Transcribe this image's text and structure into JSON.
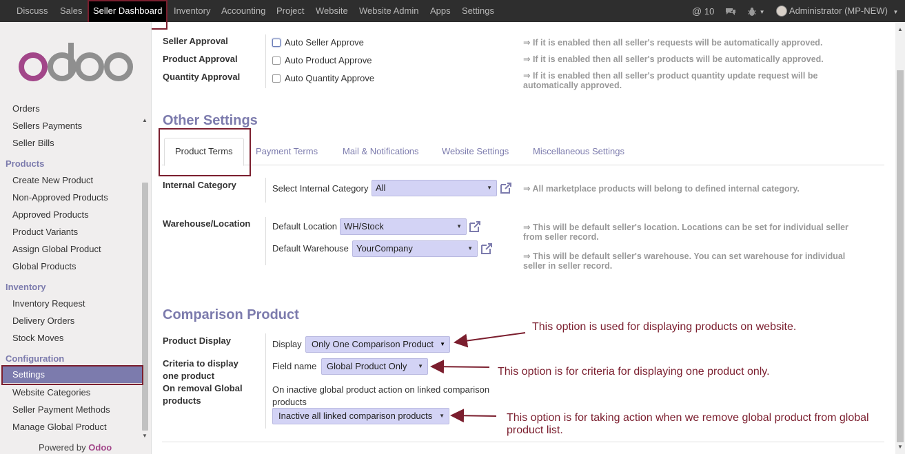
{
  "topbar": {
    "menus": [
      "Discuss",
      "Sales",
      "Seller Dashboard",
      "Inventory",
      "Accounting",
      "Project",
      "Website",
      "Website Admin",
      "Apps",
      "Settings"
    ],
    "messages_count": "10",
    "user": "Administrator (MP-NEW)"
  },
  "sidebar": {
    "items_top": [
      "Orders",
      "Sellers Payments",
      "Seller Bills"
    ],
    "products_header": "Products",
    "products_items": [
      "Create New Product",
      "Non-Approved Products",
      "Approved Products",
      "Product Variants",
      "Assign Global Product",
      "Global Products"
    ],
    "inventory_header": "Inventory",
    "inventory_items": [
      "Inventory Request",
      "Delivery Orders",
      "Stock Moves"
    ],
    "config_header": "Configuration",
    "config_items": [
      "Settings",
      "Website Categories",
      "Seller Payment Methods",
      "Manage Global Product"
    ],
    "powered_by": "Powered by",
    "powered_brand": "Odoo"
  },
  "approval": {
    "seller_label": "Seller Approval",
    "product_label": "Product Approval",
    "quantity_label": "Quantity Approval",
    "seller_option": "Auto Seller Approve",
    "product_option": "Auto Product Approve",
    "quantity_option": "Auto Quantity Approve",
    "seller_help": "⇒ If it is enabled then all seller's requests will be automatically approved.",
    "product_help": "⇒ If it is enabled then all seller's products will be automatically approved.",
    "quantity_help": "⇒ If it is enabled then all seller's product quantity update request will be automatically approved."
  },
  "other_settings": {
    "title": "Other Settings",
    "tabs": [
      "Product Terms",
      "Payment Terms",
      "Mail & Notifications",
      "Website Settings",
      "Miscellaneous Settings"
    ],
    "internal_category_label": "Internal Category",
    "select_internal_category": "Select Internal Category",
    "internal_category_value": "All",
    "internal_category_help": "⇒ All marketplace products will belong to defined internal category.",
    "warehouse_label": "Warehouse/Location",
    "default_location": "Default Location",
    "default_location_value": "WH/Stock",
    "default_warehouse": "Default Warehouse",
    "default_warehouse_value": "YourCompany",
    "location_help": "⇒ This will be default seller's location. Locations can be set for individual seller from seller record.",
    "warehouse_help": "⇒ This will be default seller's warehouse. You can set warehouse for individual seller in seller record."
  },
  "comparison": {
    "title": "Comparison Product",
    "product_display_label": "Product Display",
    "display_field": "Display",
    "display_value": "Only One Comparison Product",
    "criteria_label": "Criteria to display one product",
    "field_name": "Field name",
    "field_value": "Global Product Only",
    "removal_label": "On removal Global products",
    "removal_text": "On inactive global product action on linked comparison products",
    "removal_value": "Inactive all linked comparison products"
  },
  "annotations": {
    "display_note": "This option is used for displaying products on website.",
    "criteria_note": "This option is for criteria for displaying one product only.",
    "removal_note": "This option is for taking action when we remove  global product from global product list."
  },
  "colors": {
    "accent": "#7c7bad",
    "highlight": "#7b1e2e",
    "topbar": "#2e2e2e"
  }
}
